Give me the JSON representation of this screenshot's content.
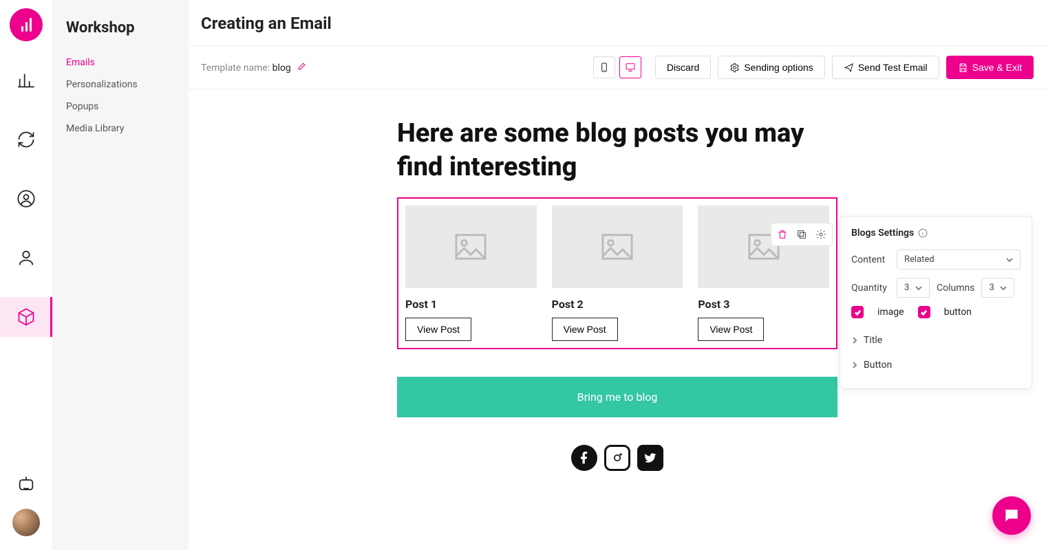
{
  "sidebar": {
    "title": "Workshop",
    "items": [
      {
        "label": "Emails",
        "active": true
      },
      {
        "label": "Personalizations"
      },
      {
        "label": "Popups"
      },
      {
        "label": "Media Library"
      }
    ]
  },
  "page": {
    "title": "Creating an Email",
    "template_label": "Template name: ",
    "template_value": "blog"
  },
  "toolbar": {
    "discard": "Discard",
    "sending": "Sending options",
    "send_test": "Send Test Email",
    "save": "Save & Exit"
  },
  "email": {
    "heading": "Here are some blog posts you may find interesting",
    "posts": [
      {
        "title": "Post 1",
        "button": "View Post"
      },
      {
        "title": "Post 2",
        "button": "View Post"
      },
      {
        "title": "Post 3",
        "button": "View Post"
      }
    ],
    "cta": "Bring me to blog"
  },
  "settings": {
    "title": "Blogs Settings",
    "content_label": "Content",
    "content_value": "Related",
    "quantity_label": "Quantity",
    "quantity_value": "3",
    "columns_label": "Columns",
    "columns_value": "3",
    "chk_image": "image",
    "chk_button": "button",
    "exp_title": "Title",
    "exp_button": "Button"
  }
}
